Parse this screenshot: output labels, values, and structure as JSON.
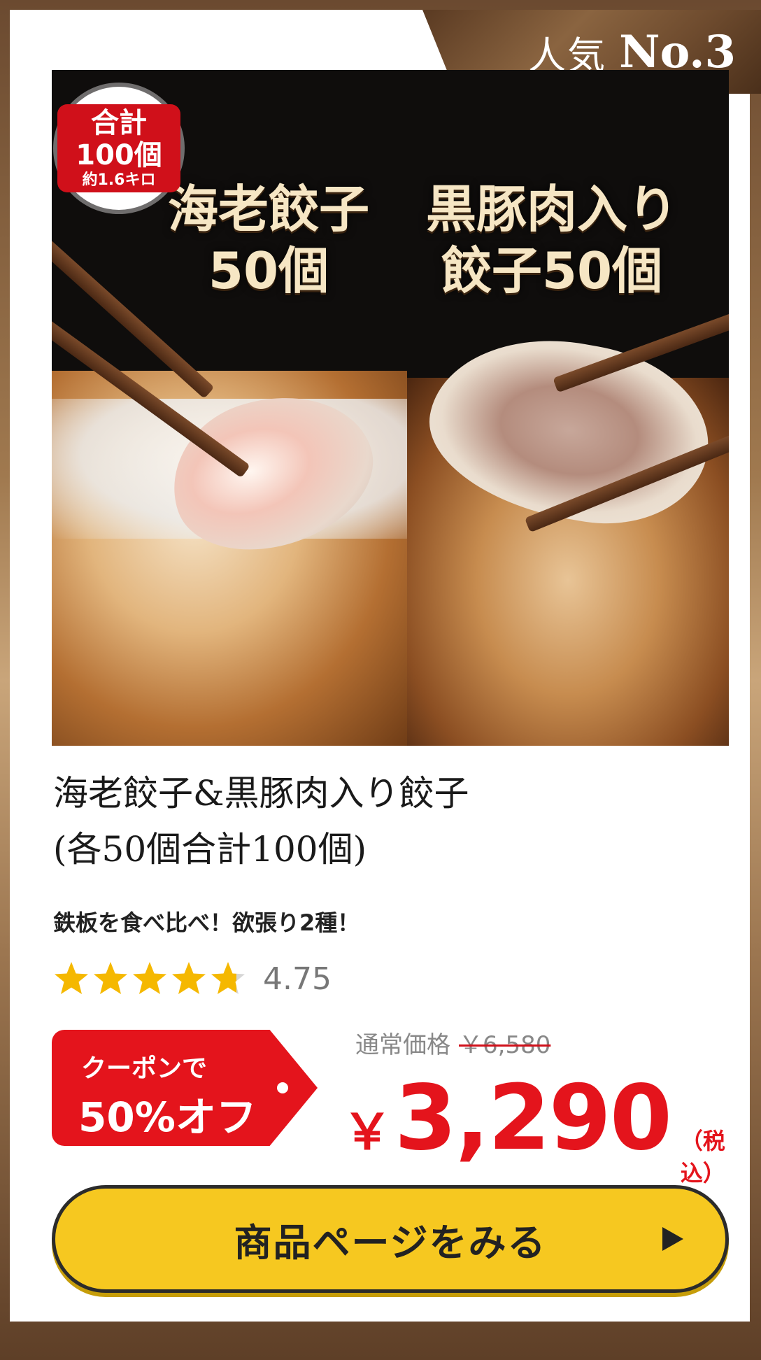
{
  "badge": {
    "prefix": "人気",
    "rank": "No.3"
  },
  "hero": {
    "stamp_line1": "合計100個",
    "stamp_line2": "約1.6キロ",
    "left_title_line1": "海老餃子",
    "left_title_line2": "50個",
    "right_title_line1": "黒豚肉入り",
    "right_title_line2": "餃子50個"
  },
  "product": {
    "title_line1": "海老餃子&黒豚肉入り餃子",
    "title_line2": "(各50個合計100個)",
    "subtitle": "鉄板を食べ比べ！欲張り2種！",
    "rating": 4.75,
    "rating_label": "4.75"
  },
  "coupon": {
    "line1": "クーポンで",
    "line2": "50%オフ"
  },
  "pricing": {
    "regular_label": "通常価格",
    "regular_price": "￥6,580",
    "currency": "￥",
    "price": "3,290",
    "tax_note": "（税込）"
  },
  "cta": {
    "label": "商品ページをみる"
  },
  "colors": {
    "accent_red": "#e4141c",
    "cta_yellow": "#f6c820",
    "star": "#f5b800"
  },
  "icons": [
    "star-icon",
    "play-arrow-icon"
  ]
}
